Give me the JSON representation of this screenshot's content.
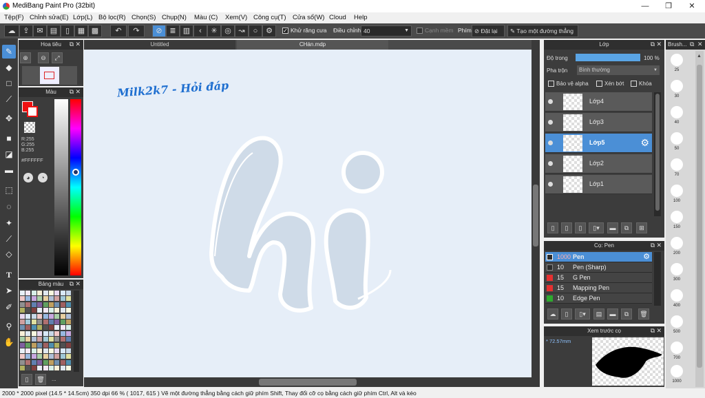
{
  "app": {
    "title": "MediBang Paint Pro (32bit)"
  },
  "window_controls": {
    "minimize": "—",
    "maximize": "❐",
    "close": "✕"
  },
  "menu": [
    "Tệp(F)",
    "Chỉnh sửa(E)",
    "Lớp(L)",
    "Bộ lọc(R)",
    "Chọn(S)",
    "Chụp(N)",
    "Màu (C)",
    "Xem(V)",
    "Công cụ(T)",
    "Cửa sổ(W)",
    "Cloud",
    "Help"
  ],
  "toolbar": {
    "antialias_label": "Khử răng cưa",
    "adjust_label": "Điều chỉnh",
    "adjust_value": "40",
    "edge_label": "Cạnh mềm",
    "key_label": "Phím",
    "reset_label": "Đặt lại",
    "straight_line_label": "Tạo một đường thẳng"
  },
  "navigator": {
    "title": "Hoa tiêu"
  },
  "color_panel": {
    "title": "Màu",
    "r": "R:255",
    "g": "G:255",
    "b": "B:255",
    "hex": "#FFFFFF"
  },
  "palette": {
    "title": "Bảng màu",
    "more": "..."
  },
  "tabs": [
    {
      "label": "Untitled"
    },
    {
      "label": "CHán.mdp"
    }
  ],
  "canvas": {
    "handwriting": "Milk2k7 - Hỏi đáp",
    "art_text": "hi"
  },
  "layers": {
    "title": "Lớp",
    "opacity_label": "Độ trong",
    "opacity_value": "100 %",
    "opacity_percent": 100,
    "blend_label": "Pha trộn",
    "blend_value": "Bình thường",
    "protect_alpha": "Bảo vệ alpha",
    "clip": "Xén bớt",
    "lock": "Khóa",
    "items": [
      {
        "name": "Lớp4",
        "selected": false
      },
      {
        "name": "Lớp3",
        "selected": false
      },
      {
        "name": "Lớp5",
        "selected": true
      },
      {
        "name": "Lớp2",
        "selected": false
      },
      {
        "name": "Lớp1",
        "selected": false
      }
    ]
  },
  "brushes": {
    "title": "Cọ: Pen",
    "items": [
      {
        "size": "1000",
        "name": "Pen",
        "color": "#2c2c2c",
        "selected": true
      },
      {
        "size": "10",
        "name": "Pen (Sharp)",
        "color": "#2c2c2c",
        "selected": false
      },
      {
        "size": "15",
        "name": "G Pen",
        "color": "#e53030",
        "selected": false
      },
      {
        "size": "15",
        "name": "Mapping Pen",
        "color": "#e53030",
        "selected": false
      },
      {
        "size": "10",
        "name": "Edge Pen",
        "color": "#2eaa2e",
        "selected": false
      }
    ]
  },
  "preview": {
    "title": "Xem trước cọ",
    "size": "* 72.57mm"
  },
  "brush_sizes": {
    "title": "Brush...",
    "sizes": [
      "25",
      "30",
      "40",
      "50",
      "70",
      "100",
      "150",
      "200",
      "300",
      "400",
      "500",
      "700",
      "1000"
    ]
  },
  "status": {
    "text": "2000 * 2000 pixel   (14.5 * 14.5cm)   350 dpi   66 %   ( 1017, 615 )   Vẽ một đường thẳng bằng cách giữ phím Shift, Thay đổi cỡ cọ bằng cách giữ phím Ctrl, Alt và kéo"
  },
  "colors": {
    "accent": "#4b8fd6",
    "canvas": "#e6eef8",
    "art": "#cfdbe8",
    "handwriting": "#1f6fd0"
  }
}
